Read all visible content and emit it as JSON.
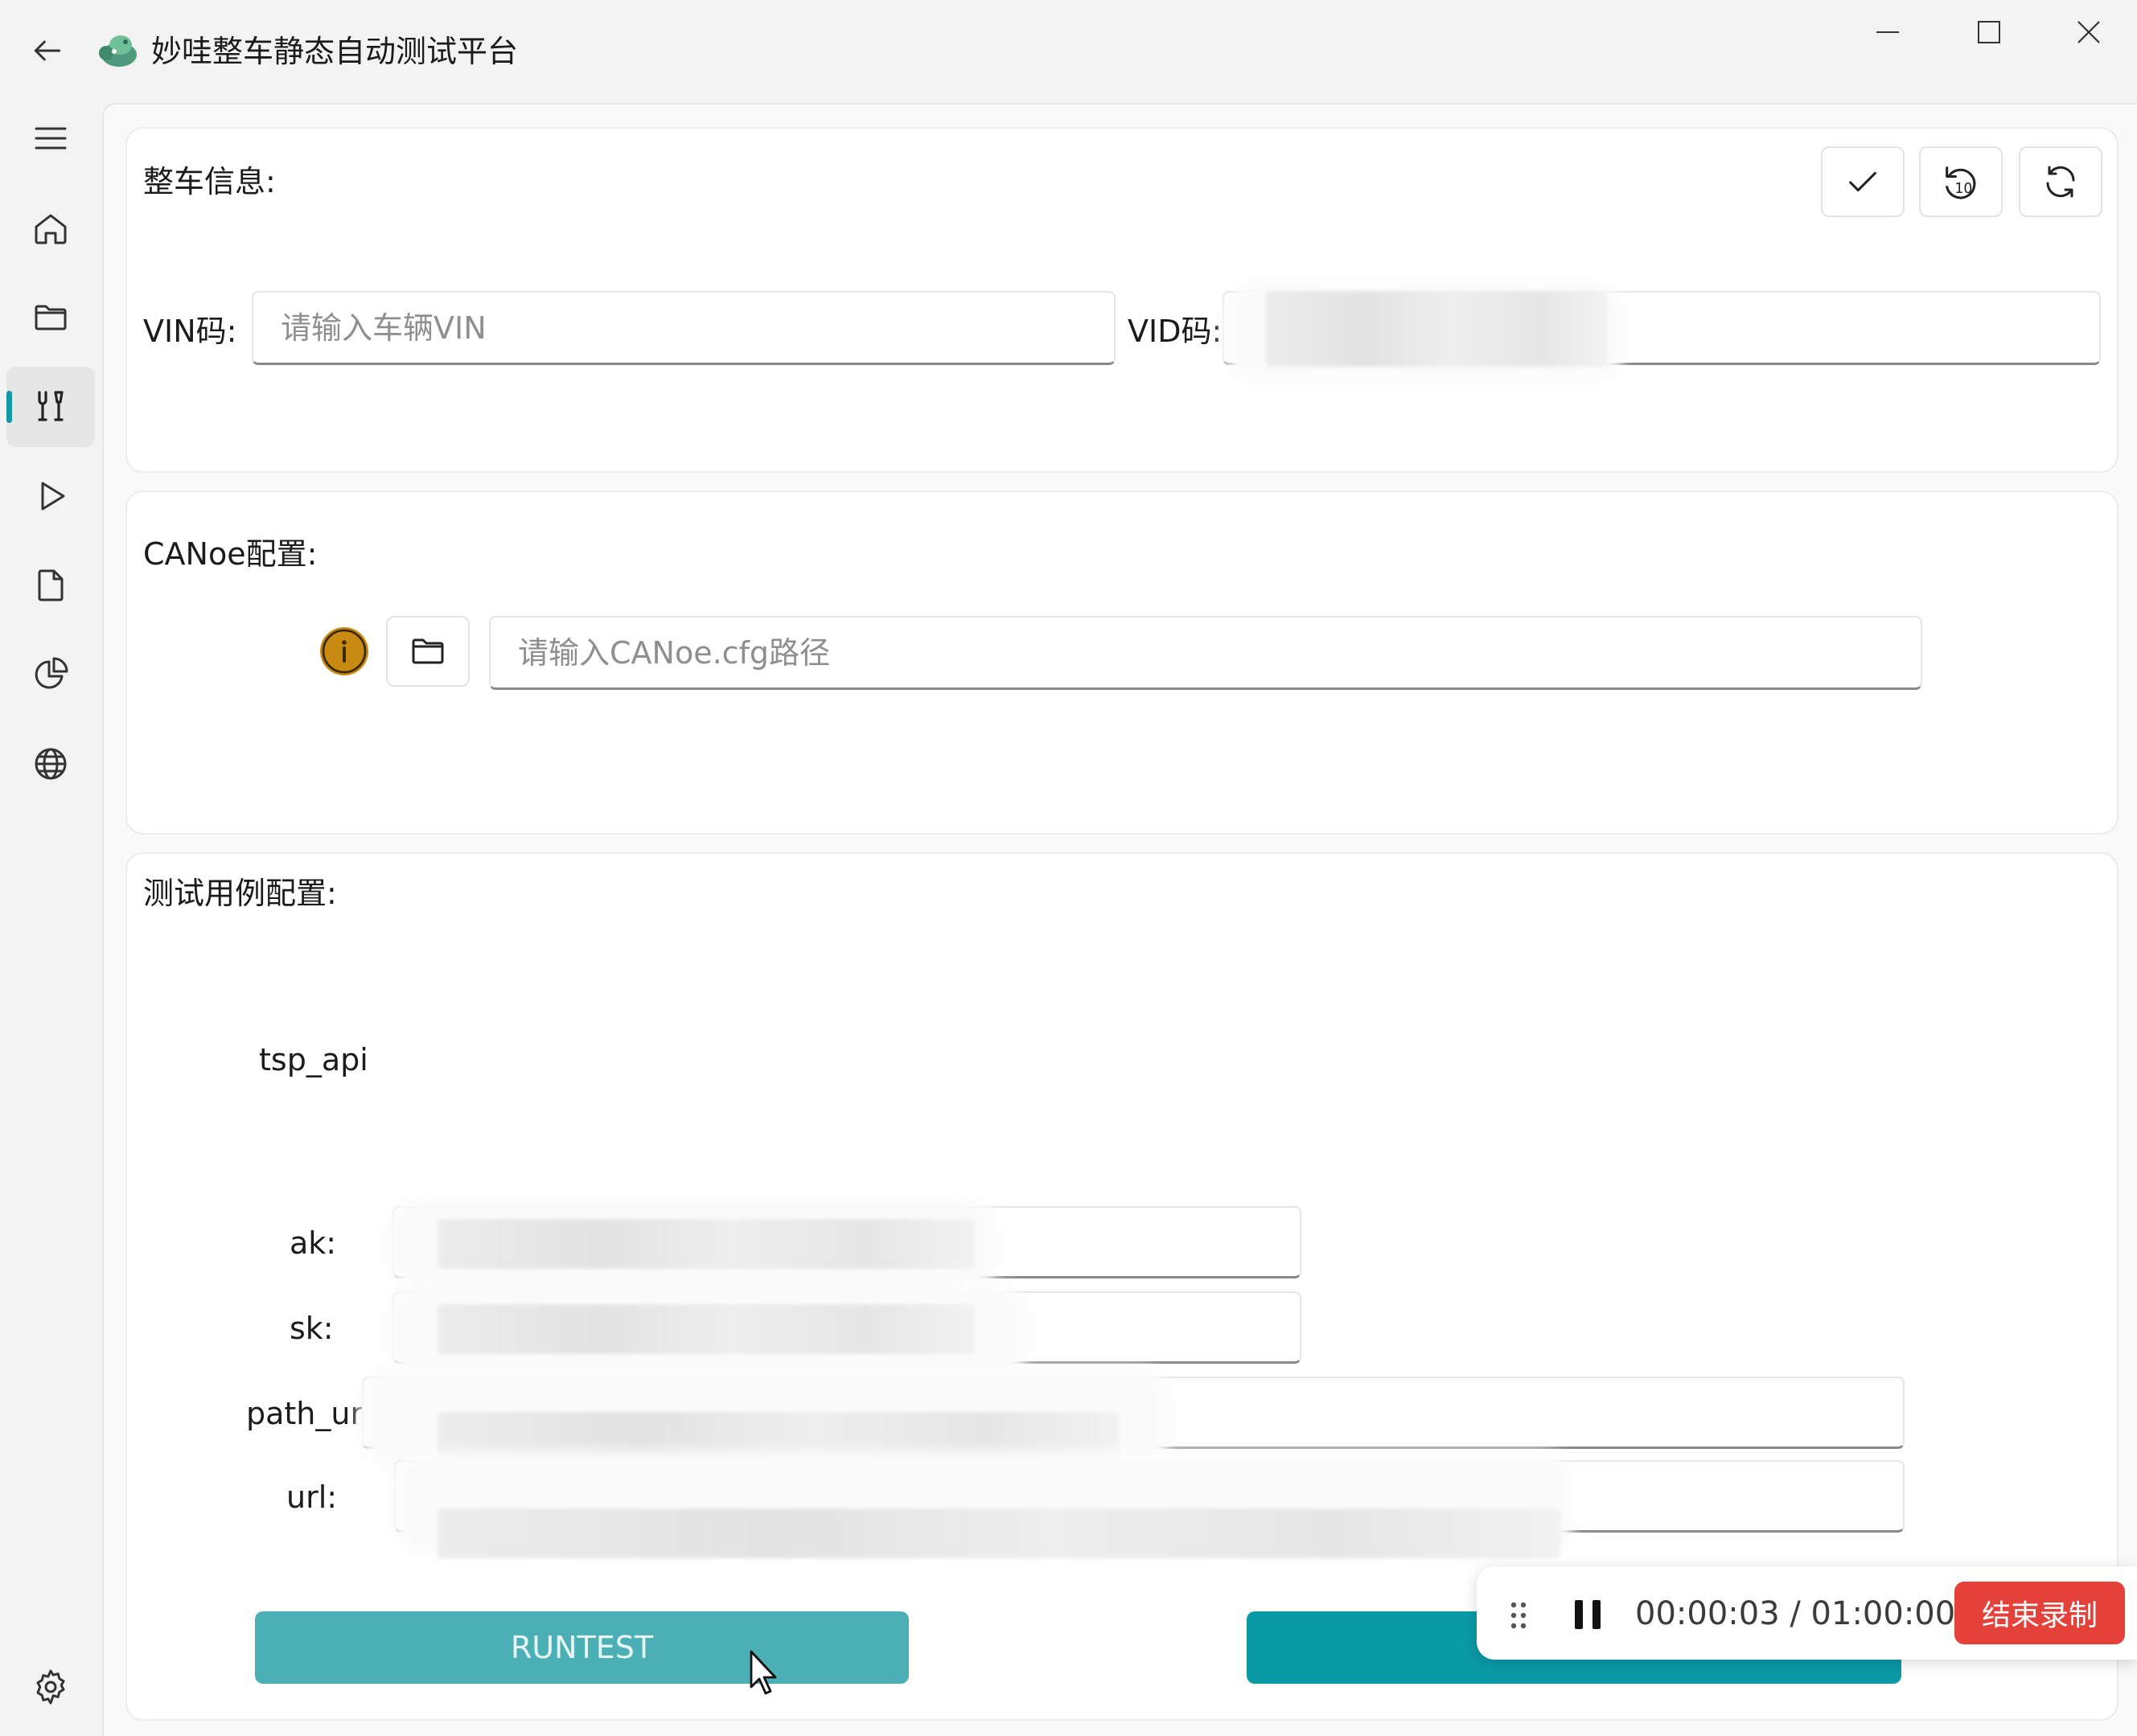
{
  "window": {
    "title": "妙哇整车静态自动测试平台",
    "icons": [
      "back-arrow-icon",
      "app-logo-icon",
      "minimize-icon",
      "maximize-icon",
      "close-icon"
    ]
  },
  "sidebar": {
    "items": [
      {
        "icon": "menu-icon"
      },
      {
        "icon": "home-icon"
      },
      {
        "icon": "folder-icon"
      },
      {
        "icon": "tools-icon",
        "active": true
      },
      {
        "icon": "play-icon"
      },
      {
        "icon": "document-icon"
      },
      {
        "icon": "pie-chart-icon"
      },
      {
        "icon": "globe-icon"
      },
      {
        "icon": "settings-icon"
      }
    ]
  },
  "vehicle_info": {
    "title": "整车信息:",
    "toolbar": [
      "check-icon",
      "rewind-10-icon",
      "refresh-icon"
    ],
    "vin_label": "VIN码:",
    "vin_placeholder": "请输入车辆VIN",
    "vid_label": "VID码:"
  },
  "canoe_config": {
    "title": "CANoe配置:",
    "path_placeholder": "请输入CANoe.cfg路径"
  },
  "test_case_config": {
    "title": "测试用例配置:",
    "group_name": "tsp_api",
    "fields": [
      "ak:",
      "sk:",
      "path_ur",
      "url:"
    ]
  },
  "actions": {
    "runtest_label": "RUNTEST"
  },
  "recording": {
    "time": "00:00:03 / 01:00:00",
    "stop_label": "结束录制"
  },
  "colors": {
    "accent": "#0a9aa6",
    "runtest_bg": "#4ab0b6",
    "stop_bg": "#e5413b",
    "info_icon": "#c98a12"
  }
}
